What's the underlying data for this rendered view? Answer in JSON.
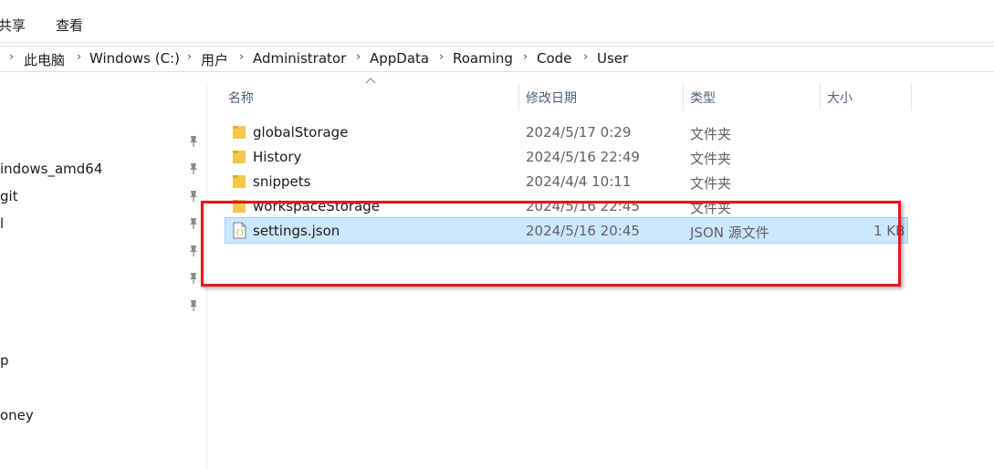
{
  "ribbon": {
    "tabs": [
      "共享",
      "查看"
    ]
  },
  "address": {
    "crumbs": [
      "此电脑",
      "Windows (C:)",
      "用户",
      "Administrator",
      "AppData",
      "Roaming",
      "Code",
      "User"
    ]
  },
  "nav": {
    "items": [
      "indows_amd64",
      "git",
      "l",
      "p",
      "oney"
    ]
  },
  "columns": {
    "name": "名称",
    "date": "修改日期",
    "type": "类型",
    "size": "大小"
  },
  "files": [
    {
      "name": "globalStorage",
      "date": "2024/5/17 0:29",
      "type": "文件夹",
      "size": "",
      "icon": "folder-icon"
    },
    {
      "name": "History",
      "date": "2024/5/16 22:49",
      "type": "文件夹",
      "size": "",
      "icon": "folder-icon"
    },
    {
      "name": "snippets",
      "date": "2024/4/4 10:11",
      "type": "文件夹",
      "size": "",
      "icon": "folder-icon"
    },
    {
      "name": "workspaceStorage",
      "date": "2024/5/16 22:45",
      "type": "文件夹",
      "size": "",
      "icon": "folder-icon"
    },
    {
      "name": "settings.json",
      "date": "2024/5/16 20:45",
      "type": "JSON 源文件",
      "size": "1 KB",
      "icon": "json-file-icon",
      "selected": true
    }
  ],
  "colors": {
    "selection": "#cce8ff",
    "selection_border": "#99d1ff",
    "annotation": "#e01b1b",
    "folder": "#f2c94c"
  }
}
